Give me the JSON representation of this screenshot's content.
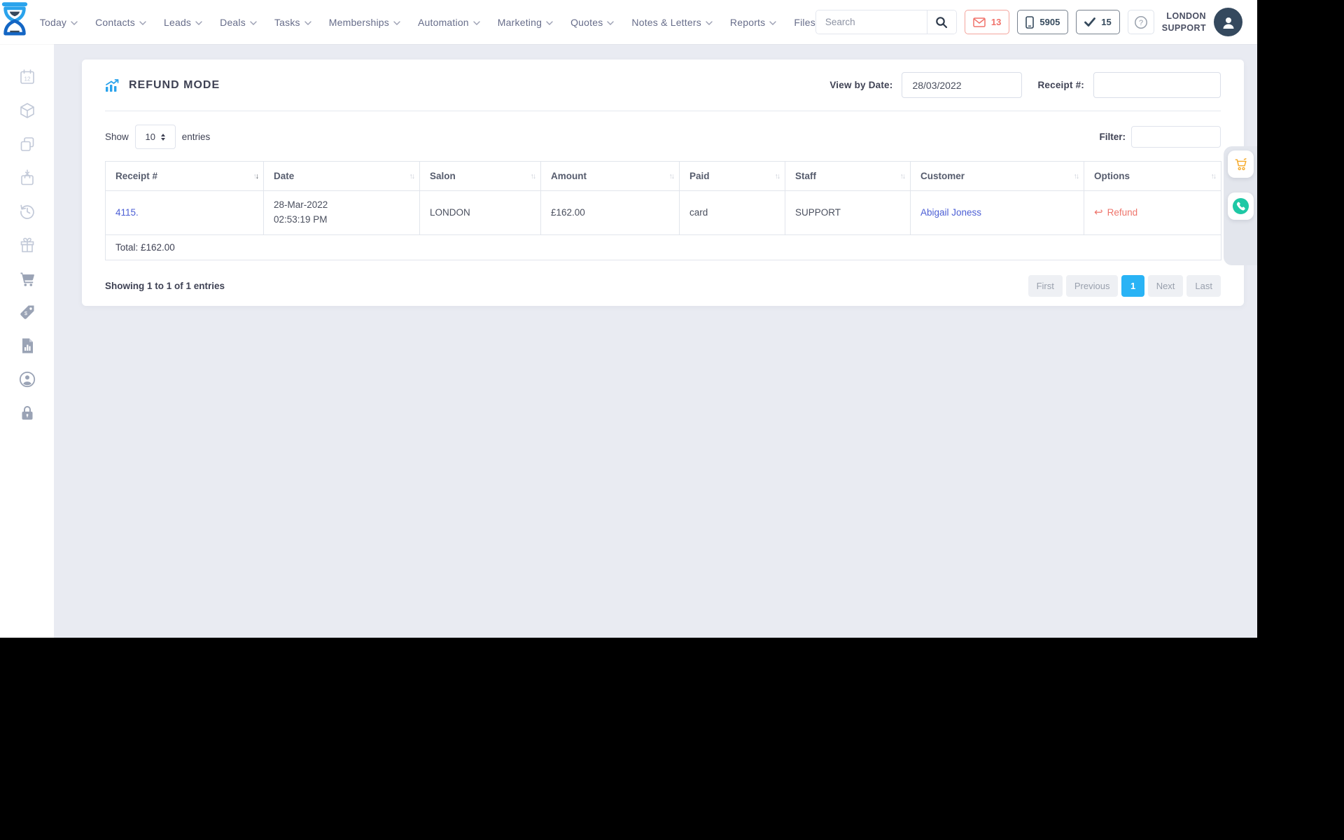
{
  "navbar": {
    "menu": [
      "Today",
      "Contacts",
      "Leads",
      "Deals",
      "Tasks",
      "Memberships",
      "Automation",
      "Marketing",
      "Quotes",
      "Notes & Letters",
      "Reports",
      "Files"
    ],
    "search_placeholder": "Search",
    "messages_count": "13",
    "phone_count": "5905",
    "check_count": "15",
    "user_line1": "LONDON",
    "user_line2": "SUPPORT"
  },
  "sidebar": {
    "icons": [
      "calendar",
      "package",
      "copy",
      "shopping-bag",
      "history",
      "gift",
      "cart",
      "price-tag",
      "report",
      "account",
      "lock"
    ]
  },
  "page": {
    "title": "REFUND MODE",
    "view_by_date_label": "View by Date:",
    "view_by_date_value": "28/03/2022",
    "receipt_label": "Receipt #:",
    "receipt_value": ""
  },
  "controls": {
    "show_label": "Show",
    "show_value": "10",
    "entries_label": "entries",
    "filter_label": "Filter:",
    "filter_value": ""
  },
  "table": {
    "columns": [
      "Receipt #",
      "Date",
      "Salon",
      "Amount",
      "Paid",
      "Staff",
      "Customer",
      "Options"
    ],
    "row": {
      "receipt": "4115.",
      "date_line1": "28-Mar-2022",
      "date_line2": "02:53:19 PM",
      "salon": "LONDON",
      "amount": "£162.00",
      "paid": "card",
      "staff": "SUPPORT",
      "customer": "Abigail Joness",
      "refund_label": "Refund"
    },
    "total": "Total: £162.00"
  },
  "footer": {
    "showing": "Showing 1 to 1 of 1 entries",
    "pages": [
      "First",
      "Previous",
      "1",
      "Next",
      "Last"
    ],
    "active_page": "1"
  },
  "floating": {
    "buttons": [
      "cart",
      "phone"
    ]
  },
  "colors": {
    "active_page": "#29b3f5",
    "link": "#4c5fd5",
    "refund": "#ee756c",
    "badge_red": "#f0726a",
    "badge_dark": "#35495c",
    "logo_light": "#2aa3ec",
    "logo_dark": "#1466c4",
    "accent_orange": "#f5a825",
    "accent_teal": "#1ec8a5"
  }
}
